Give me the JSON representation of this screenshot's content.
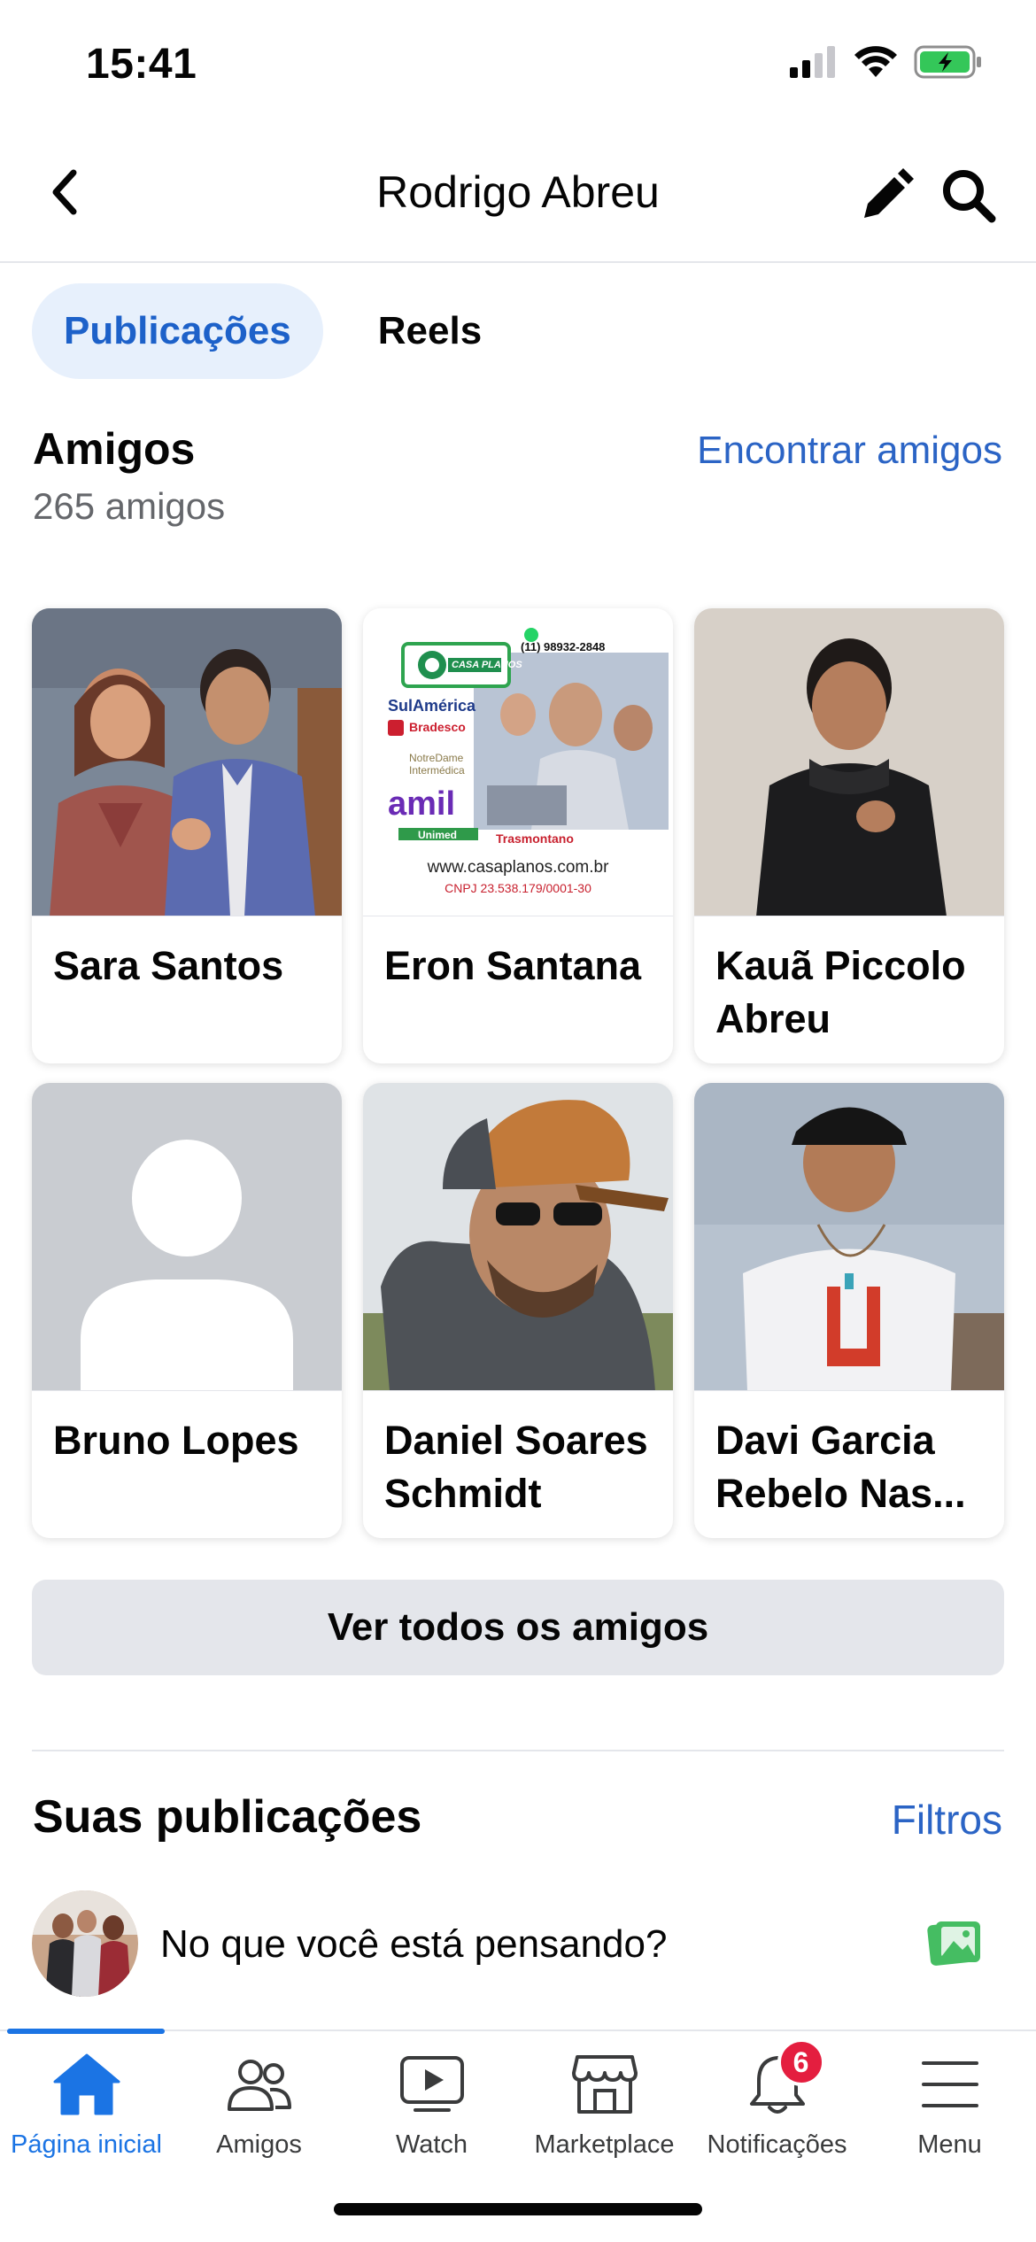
{
  "status_bar": {
    "time": "15:41"
  },
  "header": {
    "title": "Rodrigo Abreu"
  },
  "tabs": [
    {
      "label": "Publicações",
      "active": true
    },
    {
      "label": "Reels",
      "active": false
    }
  ],
  "friends": {
    "title": "Amigos",
    "count": "265 amigos",
    "find_link": "Encontrar amigos",
    "items": [
      {
        "name": "Sara Santos"
      },
      {
        "name": "Eron Santana"
      },
      {
        "name": "Kauã Piccolo Abreu"
      },
      {
        "name": "Bruno Lopes"
      },
      {
        "name": "Daniel Soares Schmidt"
      },
      {
        "name": "Davi Garcia Rebelo Nas..."
      }
    ],
    "ad_image": {
      "phone": "(11) 98932-2848",
      "brand": "CASA PLANOS",
      "logos": [
        "SulAmérica",
        "Bradesco",
        "NotreDame Intermédica",
        "amil",
        "Unimed",
        "Trasmontano"
      ],
      "website": "www.casaplanos.com.br",
      "cnpj": "CNPJ 23.538.179/0001-30"
    },
    "see_all_button": "Ver todos os amigos"
  },
  "posts": {
    "title": "Suas publicações",
    "filters_link": "Filtros",
    "composer_prompt": "No que você está pensando?"
  },
  "bottom_nav": {
    "items": [
      {
        "label": "Página inicial",
        "icon": "home-icon",
        "active": true
      },
      {
        "label": "Amigos",
        "icon": "friends-icon"
      },
      {
        "label": "Watch",
        "icon": "watch-icon"
      },
      {
        "label": "Marketplace",
        "icon": "marketplace-icon"
      },
      {
        "label": "Notificações",
        "icon": "bell-icon",
        "badge": "6"
      },
      {
        "label": "Menu",
        "icon": "menu-icon"
      }
    ]
  },
  "colors": {
    "accent": "#1b74e4",
    "link": "#2b64c5",
    "tab_active_bg": "#e7f0fc",
    "badge": "#e41e3f",
    "photo_icon": "#45bd62"
  }
}
